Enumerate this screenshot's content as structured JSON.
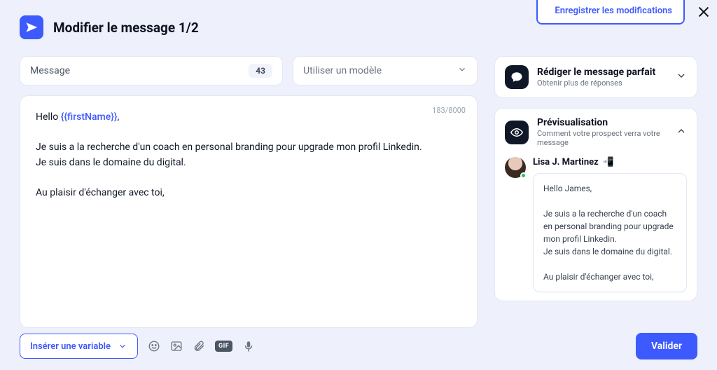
{
  "topbar": {
    "save_label": "Enregistrer les modifications"
  },
  "header": {
    "title": "Modifier le message 1/2"
  },
  "message_field": {
    "label": "Message",
    "count": "43"
  },
  "template_select": {
    "placeholder": "Utiliser un modèle"
  },
  "editor": {
    "counter": "183/8000",
    "greeting_prefix": "Hello ",
    "variable_token": "{{firstName}}",
    "greeting_suffix": ",",
    "body": "Je suis a la recherche d'un coach en personal branding pour upgrade mon profil Linkedin.\nJe suis dans le domaine du digital.\n\nAu plaisir d'échanger avec toi,"
  },
  "tips_panel": {
    "title": "Rédiger le message parfait",
    "subtitle": "Obtenir plus de réponses"
  },
  "preview_panel": {
    "title": "Prévisualisation",
    "subtitle": "Comment votre prospect verra votre message",
    "sender_name": "Lisa J. Martinez",
    "sender_emoji": "📲",
    "bubble": "Hello James,\n\nJe suis a la recherche d'un coach en personal branding pour upgrade mon profil Linkedin.\nJe suis dans le domaine du digital.\n\nAu plaisir d'échanger avec toi,"
  },
  "footer": {
    "insert_variable": "Insérer une variable",
    "gif_label": "GIF",
    "validate": "Valider"
  }
}
